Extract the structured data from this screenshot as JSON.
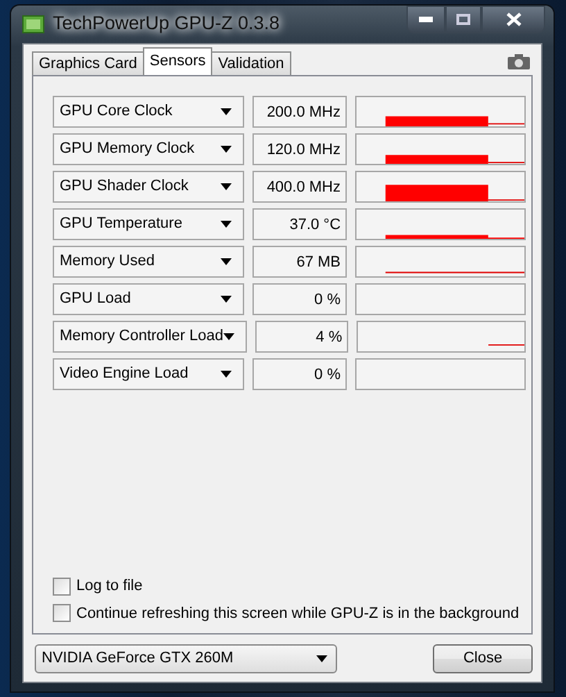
{
  "window": {
    "title": "TechPowerUp GPU-Z 0.3.8"
  },
  "tabs": [
    {
      "label": "Graphics Card",
      "selected": false
    },
    {
      "label": "Sensors",
      "selected": true
    },
    {
      "label": "Validation",
      "selected": false
    }
  ],
  "sensors": [
    {
      "name": "GPU Core Clock",
      "reading": "200.0 MHz"
    },
    {
      "name": "GPU Memory Clock",
      "reading": "120.0 MHz"
    },
    {
      "name": "GPU Shader Clock",
      "reading": "400.0 MHz"
    },
    {
      "name": "GPU Temperature",
      "reading": "37.0 °C"
    },
    {
      "name": "Memory Used",
      "reading": "67 MB"
    },
    {
      "name": "GPU Load",
      "reading": "0 %"
    },
    {
      "name": "Memory Controller Load",
      "reading": "4 %"
    },
    {
      "name": "Video Engine Load",
      "reading": "0 %"
    }
  ],
  "options": [
    {
      "label": "Log to file",
      "checked": false
    },
    {
      "label": "Continue refreshing this screen while GPU-Z is in the background",
      "checked": false
    }
  ],
  "gpu_select": {
    "value": "NVIDIA GeForce GTX 260M"
  },
  "buttons": [
    {
      "label": "Close"
    }
  ]
}
